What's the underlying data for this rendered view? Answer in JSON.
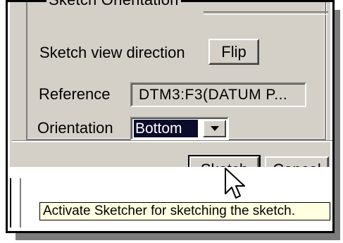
{
  "group": {
    "legend": "Sketch Orientation"
  },
  "sketch_view_direction": {
    "label": "Sketch view direction",
    "button": "Flip"
  },
  "reference": {
    "label": "Reference",
    "value": "DTM3:F3(DATUM P..."
  },
  "orientation": {
    "label": "Orientation",
    "value": "Bottom",
    "arrow_icon": "dropdown-arrow"
  },
  "actions": {
    "sketch": "Sketch",
    "cancel": "Cancel"
  },
  "tooltip": {
    "text": "Activate Sketcher for sketching the sketch."
  },
  "cursor": {
    "icon": "arrow-pointer"
  },
  "colors": {
    "dialog": "#d4d0c8",
    "selection": "#0a0a2a",
    "tooltip": "#ffffe1"
  }
}
